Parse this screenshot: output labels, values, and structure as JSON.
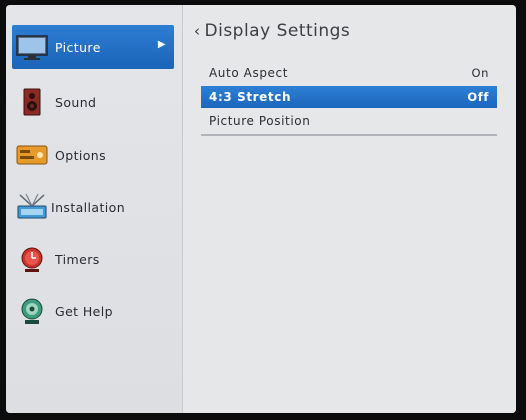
{
  "sidebar": {
    "items": [
      {
        "label": "Picture",
        "icon": "monitor-icon",
        "active": true
      },
      {
        "label": "Sound",
        "icon": "speaker-icon"
      },
      {
        "label": "Options",
        "icon": "options-panel-icon"
      },
      {
        "label": "Installation",
        "icon": "antenna-icon"
      },
      {
        "label": "Timers",
        "icon": "timer-icon"
      },
      {
        "label": "Get Help",
        "icon": "help-icon"
      }
    ],
    "active_arrow": "▶"
  },
  "panel": {
    "back_glyph": "‹",
    "title": "Display Settings",
    "rows": [
      {
        "label": "Auto Aspect",
        "value": "On"
      },
      {
        "label": "4:3 Stretch",
        "value": "Off",
        "selected": true
      },
      {
        "label": "Picture Position",
        "value": ""
      }
    ]
  },
  "colors": {
    "accent": "#1f6fc6",
    "background": "#e6e7e9"
  }
}
